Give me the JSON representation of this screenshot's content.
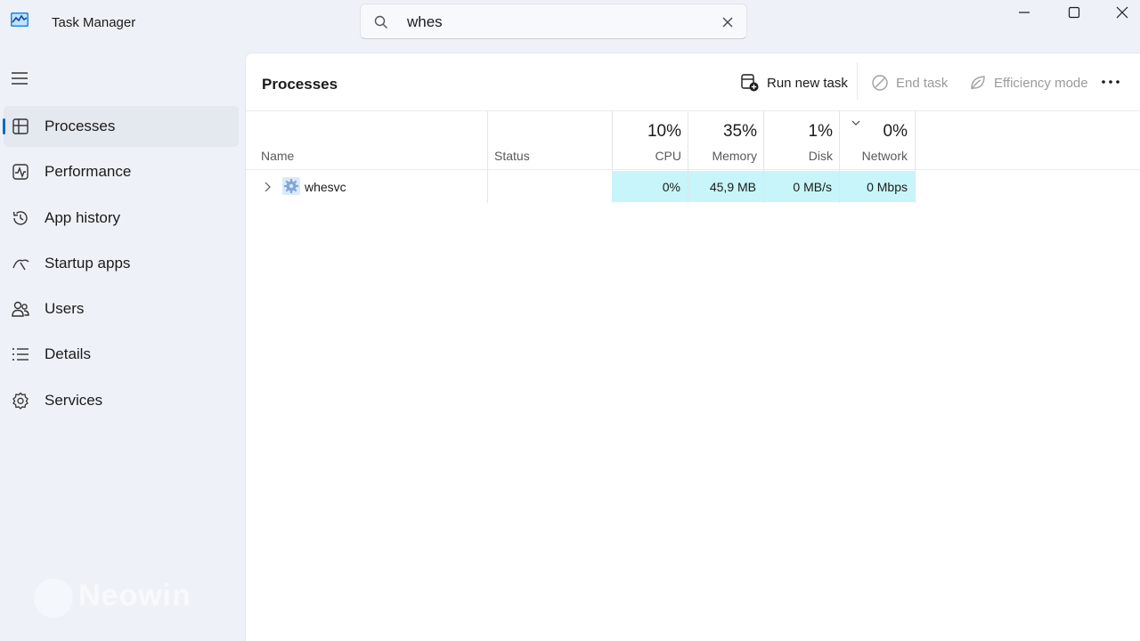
{
  "app": {
    "title": "Task Manager"
  },
  "search": {
    "value": "whes",
    "placeholder": ""
  },
  "sidebar": {
    "items": [
      {
        "label": "Processes",
        "icon": "processes-icon",
        "active": true
      },
      {
        "label": "Performance",
        "icon": "performance-icon"
      },
      {
        "label": "App history",
        "icon": "app-history-icon"
      },
      {
        "label": "Startup apps",
        "icon": "startup-apps-icon"
      },
      {
        "label": "Users",
        "icon": "users-icon"
      },
      {
        "label": "Details",
        "icon": "details-icon"
      },
      {
        "label": "Services",
        "icon": "services-icon"
      }
    ]
  },
  "main": {
    "title": "Processes",
    "toolbar": {
      "run_new_task": "Run new task",
      "end_task": "End task",
      "efficiency_mode": "Efficiency mode"
    },
    "columns": {
      "name": "Name",
      "status": "Status",
      "cpu": {
        "percent": "10%",
        "label": "CPU"
      },
      "memory": {
        "percent": "35%",
        "label": "Memory"
      },
      "disk": {
        "percent": "1%",
        "label": "Disk"
      },
      "network": {
        "percent": "0%",
        "label": "Network"
      }
    },
    "rows": [
      {
        "name": "whesvc",
        "status": "",
        "cpu": "0%",
        "memory": "45,9 MB",
        "disk": "0 MB/s",
        "network": "0 Mbps"
      }
    ]
  },
  "watermark": {
    "text": "Neowin"
  },
  "colors": {
    "accent": "#0f6cbd",
    "highlight": "#c7f5fa",
    "background": "#eef2f8"
  }
}
